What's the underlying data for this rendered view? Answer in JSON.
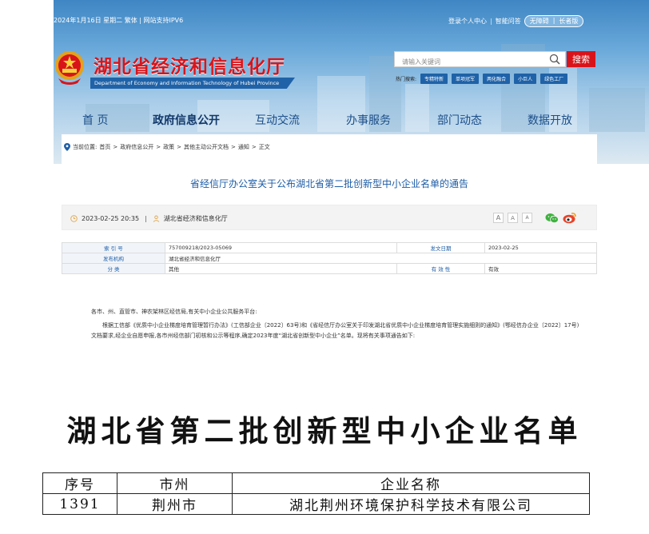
{
  "site": {
    "topbar": {
      "date_text": "2024年1月16日 星期二 繁体 | 网站支持IPV6",
      "links": [
        "登录个人中心",
        "智能问答"
      ],
      "pill_links": [
        "无障碍",
        "长者版"
      ]
    },
    "logo": {
      "title": "湖北省经济和信息化厅",
      "subtitle": "Department of Economy and Information Technology of Hubei Province"
    },
    "search": {
      "placeholder": "请输入关键词",
      "button_label": "搜索",
      "hot_label": "热门搜索:",
      "hot_tags": [
        "专精特新",
        "单项冠军",
        "两化融合",
        "小巨人",
        "绿色工厂"
      ]
    },
    "nav": [
      "首 页",
      "政府信息公开",
      "互动交流",
      "办事服务",
      "部门动态",
      "数据开放"
    ],
    "breadcrumb": {
      "prefix": "当前位置:",
      "items": [
        "首页",
        "政府信息公开",
        "政策",
        "其他主动公开文档",
        "通知",
        "正文"
      ],
      "separator": ">"
    },
    "article": {
      "title": "省经信厅办公室关于公布湖北省第二批创新型中小企业名单的通告",
      "datetime": "2023-02-25 20:35",
      "source": "湖北省经济和信息化厅",
      "font_sizes": [
        "A",
        "A",
        "A"
      ],
      "info": {
        "index_label": "索 引 号",
        "index_value": "757009218/2023-05069",
        "date_label": "发文日期",
        "date_value": "2023-02-25",
        "org_label": "发布机构",
        "org_value": "湖北省经济和信息化厅",
        "category_label": "分 类",
        "category_value": "其他",
        "validity_label": "有 效 性",
        "validity_value": "有效"
      },
      "body": [
        "各市、州、直管市、神农架林区经信局,有关中小企业公共服务平台:",
        "根据工信部《优质中小企业梯度培育管理暂行办法》(工信部企业〔2022〕63号)和《省经信厅办公室关于印发湖北省优质中小企业梯度培育管理实施细则的通知》(鄂经信办企业〔2022〕17号)文档要求,经企业自愿申报,各市州经信部门初核和公示等程序,确定2023年度“湖北省创新型中小企业”名单。现将有关事项通告如下:"
      ]
    }
  },
  "poster": {
    "title": "湖北省第二批创新型中小企业名单",
    "columns": [
      "序号",
      "市州",
      "企业名称"
    ],
    "rows": [
      [
        "1391",
        "荆州市",
        "湖北荆州环境保护科学技术有限公司"
      ]
    ]
  },
  "colors": {
    "accent_red": "#d8141a",
    "nav_blue": "#1d4f8a",
    "link_blue": "#1d5da6",
    "tag_blue": "#1f62a8"
  }
}
